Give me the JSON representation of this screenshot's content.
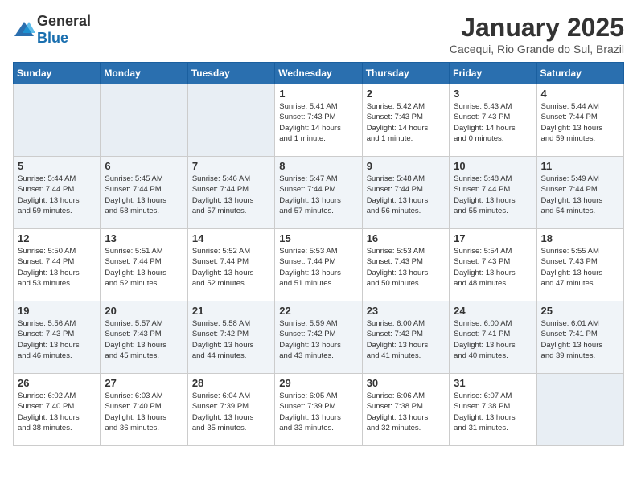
{
  "logo": {
    "general": "General",
    "blue": "Blue"
  },
  "header": {
    "title": "January 2025",
    "subtitle": "Cacequi, Rio Grande do Sul, Brazil"
  },
  "weekdays": [
    "Sunday",
    "Monday",
    "Tuesday",
    "Wednesday",
    "Thursday",
    "Friday",
    "Saturday"
  ],
  "weeks": [
    [
      {
        "day": "",
        "info": ""
      },
      {
        "day": "",
        "info": ""
      },
      {
        "day": "",
        "info": ""
      },
      {
        "day": "1",
        "info": "Sunrise: 5:41 AM\nSunset: 7:43 PM\nDaylight: 14 hours\nand 1 minute."
      },
      {
        "day": "2",
        "info": "Sunrise: 5:42 AM\nSunset: 7:43 PM\nDaylight: 14 hours\nand 1 minute."
      },
      {
        "day": "3",
        "info": "Sunrise: 5:43 AM\nSunset: 7:43 PM\nDaylight: 14 hours\nand 0 minutes."
      },
      {
        "day": "4",
        "info": "Sunrise: 5:44 AM\nSunset: 7:44 PM\nDaylight: 13 hours\nand 59 minutes."
      }
    ],
    [
      {
        "day": "5",
        "info": "Sunrise: 5:44 AM\nSunset: 7:44 PM\nDaylight: 13 hours\nand 59 minutes."
      },
      {
        "day": "6",
        "info": "Sunrise: 5:45 AM\nSunset: 7:44 PM\nDaylight: 13 hours\nand 58 minutes."
      },
      {
        "day": "7",
        "info": "Sunrise: 5:46 AM\nSunset: 7:44 PM\nDaylight: 13 hours\nand 57 minutes."
      },
      {
        "day": "8",
        "info": "Sunrise: 5:47 AM\nSunset: 7:44 PM\nDaylight: 13 hours\nand 57 minutes."
      },
      {
        "day": "9",
        "info": "Sunrise: 5:48 AM\nSunset: 7:44 PM\nDaylight: 13 hours\nand 56 minutes."
      },
      {
        "day": "10",
        "info": "Sunrise: 5:48 AM\nSunset: 7:44 PM\nDaylight: 13 hours\nand 55 minutes."
      },
      {
        "day": "11",
        "info": "Sunrise: 5:49 AM\nSunset: 7:44 PM\nDaylight: 13 hours\nand 54 minutes."
      }
    ],
    [
      {
        "day": "12",
        "info": "Sunrise: 5:50 AM\nSunset: 7:44 PM\nDaylight: 13 hours\nand 53 minutes."
      },
      {
        "day": "13",
        "info": "Sunrise: 5:51 AM\nSunset: 7:44 PM\nDaylight: 13 hours\nand 52 minutes."
      },
      {
        "day": "14",
        "info": "Sunrise: 5:52 AM\nSunset: 7:44 PM\nDaylight: 13 hours\nand 52 minutes."
      },
      {
        "day": "15",
        "info": "Sunrise: 5:53 AM\nSunset: 7:44 PM\nDaylight: 13 hours\nand 51 minutes."
      },
      {
        "day": "16",
        "info": "Sunrise: 5:53 AM\nSunset: 7:43 PM\nDaylight: 13 hours\nand 50 minutes."
      },
      {
        "day": "17",
        "info": "Sunrise: 5:54 AM\nSunset: 7:43 PM\nDaylight: 13 hours\nand 48 minutes."
      },
      {
        "day": "18",
        "info": "Sunrise: 5:55 AM\nSunset: 7:43 PM\nDaylight: 13 hours\nand 47 minutes."
      }
    ],
    [
      {
        "day": "19",
        "info": "Sunrise: 5:56 AM\nSunset: 7:43 PM\nDaylight: 13 hours\nand 46 minutes."
      },
      {
        "day": "20",
        "info": "Sunrise: 5:57 AM\nSunset: 7:43 PM\nDaylight: 13 hours\nand 45 minutes."
      },
      {
        "day": "21",
        "info": "Sunrise: 5:58 AM\nSunset: 7:42 PM\nDaylight: 13 hours\nand 44 minutes."
      },
      {
        "day": "22",
        "info": "Sunrise: 5:59 AM\nSunset: 7:42 PM\nDaylight: 13 hours\nand 43 minutes."
      },
      {
        "day": "23",
        "info": "Sunrise: 6:00 AM\nSunset: 7:42 PM\nDaylight: 13 hours\nand 41 minutes."
      },
      {
        "day": "24",
        "info": "Sunrise: 6:00 AM\nSunset: 7:41 PM\nDaylight: 13 hours\nand 40 minutes."
      },
      {
        "day": "25",
        "info": "Sunrise: 6:01 AM\nSunset: 7:41 PM\nDaylight: 13 hours\nand 39 minutes."
      }
    ],
    [
      {
        "day": "26",
        "info": "Sunrise: 6:02 AM\nSunset: 7:40 PM\nDaylight: 13 hours\nand 38 minutes."
      },
      {
        "day": "27",
        "info": "Sunrise: 6:03 AM\nSunset: 7:40 PM\nDaylight: 13 hours\nand 36 minutes."
      },
      {
        "day": "28",
        "info": "Sunrise: 6:04 AM\nSunset: 7:39 PM\nDaylight: 13 hours\nand 35 minutes."
      },
      {
        "day": "29",
        "info": "Sunrise: 6:05 AM\nSunset: 7:39 PM\nDaylight: 13 hours\nand 33 minutes."
      },
      {
        "day": "30",
        "info": "Sunrise: 6:06 AM\nSunset: 7:38 PM\nDaylight: 13 hours\nand 32 minutes."
      },
      {
        "day": "31",
        "info": "Sunrise: 6:07 AM\nSunset: 7:38 PM\nDaylight: 13 hours\nand 31 minutes."
      },
      {
        "day": "",
        "info": ""
      }
    ]
  ]
}
